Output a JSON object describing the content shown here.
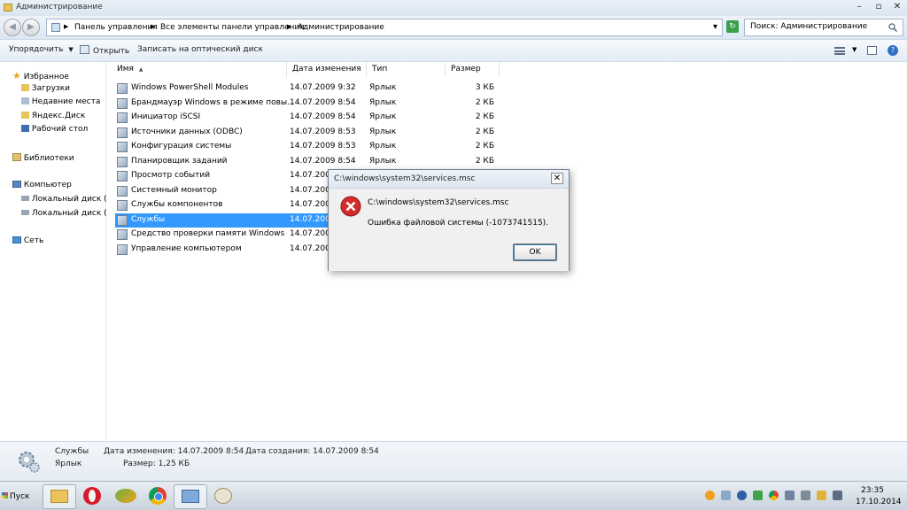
{
  "window": {
    "title": "Администрирование",
    "minimize": "–",
    "maximize": "▫",
    "close": "✕"
  },
  "address": {
    "back": "◀",
    "forward": "▶",
    "crumbs": [
      "Панель управления",
      "Все элементы панели управления",
      "Администрирование"
    ],
    "arrow": "▶",
    "dropdown": "▾",
    "refresh": "↻"
  },
  "search": {
    "value": "Поиск: Администрирование"
  },
  "toolbar": {
    "organize": "Упорядочить",
    "open": "Открыть",
    "burn": "Записать на оптический диск"
  },
  "nav": {
    "favorites": "Избранное",
    "downloads": "Загрузки",
    "recent": "Недавние места",
    "yandex": "Яндекс.Диск",
    "desktop": "Рабочий стол",
    "libraries": "Библиотеки",
    "computer": "Компьютер",
    "disk_c": "Локальный диск (C",
    "disk_d": "Локальный диск (D",
    "network": "Сеть"
  },
  "columns": {
    "name": "Имя",
    "date": "Дата изменения",
    "type": "Тип",
    "size": "Размер"
  },
  "files": [
    {
      "name": "Windows PowerShell Modules",
      "date": "14.07.2009 9:32",
      "type": "Ярлык",
      "size": "3 КБ"
    },
    {
      "name": "Брандмауэр Windows в режиме повы...",
      "date": "14.07.2009 8:54",
      "type": "Ярлык",
      "size": "2 КБ"
    },
    {
      "name": "Инициатор iSCSI",
      "date": "14.07.2009 8:54",
      "type": "Ярлык",
      "size": "2 КБ"
    },
    {
      "name": "Источники данных (ODBC)",
      "date": "14.07.2009 8:53",
      "type": "Ярлык",
      "size": "2 КБ"
    },
    {
      "name": "Конфигурация системы",
      "date": "14.07.2009 8:53",
      "type": "Ярлык",
      "size": "2 КБ"
    },
    {
      "name": "Планировщик заданий",
      "date": "14.07.2009 8:54",
      "type": "Ярлык",
      "size": "2 КБ"
    },
    {
      "name": "Просмотр событий",
      "date": "14.07.2009",
      "type": "",
      "size": ""
    },
    {
      "name": "Системный монитор",
      "date": "14.07.2009",
      "type": "",
      "size": ""
    },
    {
      "name": "Службы компонентов",
      "date": "14.07.2009",
      "type": "",
      "size": ""
    },
    {
      "name": "Службы",
      "date": "14.07.2009",
      "type": "",
      "size": ""
    },
    {
      "name": "Средство проверки памяти Windows",
      "date": "14.07.2009",
      "type": "",
      "size": ""
    },
    {
      "name": "Управление компьютером",
      "date": "14.07.2009",
      "type": "",
      "size": ""
    }
  ],
  "details": {
    "name": "Службы",
    "modified": "Дата изменения: 14.07.2009 8:54",
    "created": "Дата создания: 14.07.2009 8:54",
    "type": "Ярлык",
    "size": "Размер: 1,25 КБ"
  },
  "dialog": {
    "title": "C:\\windows\\system32\\services.msc",
    "path": "C:\\windows\\system32\\services.msc",
    "message": "Ошибка файловой системы (-1073741515).",
    "ok": "OK",
    "close": "✕"
  },
  "taskbar": {
    "start": "Пуск",
    "time": "23:35",
    "date": "17.10.2014"
  }
}
